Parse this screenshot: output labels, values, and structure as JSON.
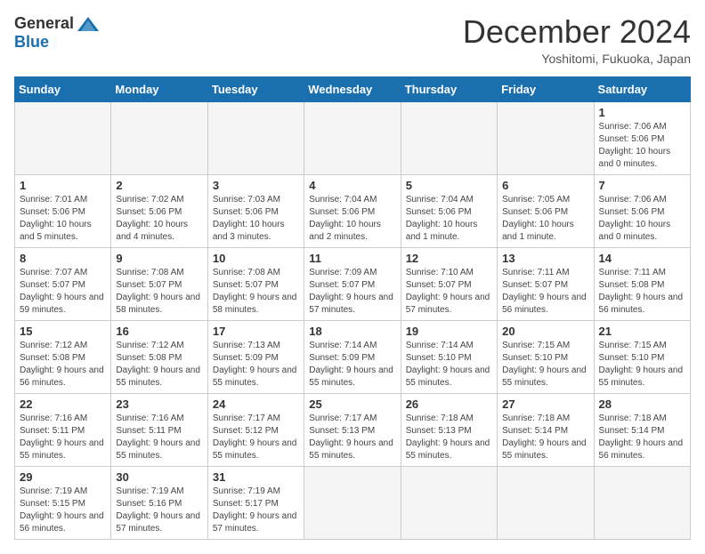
{
  "header": {
    "logo_general": "General",
    "logo_blue": "Blue",
    "month_title": "December 2024",
    "subtitle": "Yoshitomi, Fukuoka, Japan"
  },
  "calendar": {
    "days_of_week": [
      "Sunday",
      "Monday",
      "Tuesday",
      "Wednesday",
      "Thursday",
      "Friday",
      "Saturday"
    ],
    "weeks": [
      [
        {
          "day": "",
          "empty": true
        },
        {
          "day": "",
          "empty": true
        },
        {
          "day": "",
          "empty": true
        },
        {
          "day": "",
          "empty": true
        },
        {
          "day": "",
          "empty": true
        },
        {
          "day": "",
          "empty": true
        },
        {
          "day": "1",
          "sunrise": "7:06 AM",
          "sunset": "5:06 PM",
          "daylight": "10 hours and 0 minutes."
        }
      ],
      [
        {
          "day": "1",
          "sunrise": "7:01 AM",
          "sunset": "5:06 PM",
          "daylight": "10 hours and 5 minutes."
        },
        {
          "day": "2",
          "sunrise": "7:02 AM",
          "sunset": "5:06 PM",
          "daylight": "10 hours and 4 minutes."
        },
        {
          "day": "3",
          "sunrise": "7:03 AM",
          "sunset": "5:06 PM",
          "daylight": "10 hours and 3 minutes."
        },
        {
          "day": "4",
          "sunrise": "7:04 AM",
          "sunset": "5:06 PM",
          "daylight": "10 hours and 2 minutes."
        },
        {
          "day": "5",
          "sunrise": "7:04 AM",
          "sunset": "5:06 PM",
          "daylight": "10 hours and 1 minute."
        },
        {
          "day": "6",
          "sunrise": "7:05 AM",
          "sunset": "5:06 PM",
          "daylight": "10 hours and 1 minute."
        },
        {
          "day": "7",
          "sunrise": "7:06 AM",
          "sunset": "5:06 PM",
          "daylight": "10 hours and 0 minutes."
        }
      ],
      [
        {
          "day": "8",
          "sunrise": "7:07 AM",
          "sunset": "5:07 PM",
          "daylight": "9 hours and 59 minutes."
        },
        {
          "day": "9",
          "sunrise": "7:08 AM",
          "sunset": "5:07 PM",
          "daylight": "9 hours and 58 minutes."
        },
        {
          "day": "10",
          "sunrise": "7:08 AM",
          "sunset": "5:07 PM",
          "daylight": "9 hours and 58 minutes."
        },
        {
          "day": "11",
          "sunrise": "7:09 AM",
          "sunset": "5:07 PM",
          "daylight": "9 hours and 57 minutes."
        },
        {
          "day": "12",
          "sunrise": "7:10 AM",
          "sunset": "5:07 PM",
          "daylight": "9 hours and 57 minutes."
        },
        {
          "day": "13",
          "sunrise": "7:11 AM",
          "sunset": "5:07 PM",
          "daylight": "9 hours and 56 minutes."
        },
        {
          "day": "14",
          "sunrise": "7:11 AM",
          "sunset": "5:08 PM",
          "daylight": "9 hours and 56 minutes."
        }
      ],
      [
        {
          "day": "15",
          "sunrise": "7:12 AM",
          "sunset": "5:08 PM",
          "daylight": "9 hours and 56 minutes."
        },
        {
          "day": "16",
          "sunrise": "7:12 AM",
          "sunset": "5:08 PM",
          "daylight": "9 hours and 55 minutes."
        },
        {
          "day": "17",
          "sunrise": "7:13 AM",
          "sunset": "5:09 PM",
          "daylight": "9 hours and 55 minutes."
        },
        {
          "day": "18",
          "sunrise": "7:14 AM",
          "sunset": "5:09 PM",
          "daylight": "9 hours and 55 minutes."
        },
        {
          "day": "19",
          "sunrise": "7:14 AM",
          "sunset": "5:10 PM",
          "daylight": "9 hours and 55 minutes."
        },
        {
          "day": "20",
          "sunrise": "7:15 AM",
          "sunset": "5:10 PM",
          "daylight": "9 hours and 55 minutes."
        },
        {
          "day": "21",
          "sunrise": "7:15 AM",
          "sunset": "5:10 PM",
          "daylight": "9 hours and 55 minutes."
        }
      ],
      [
        {
          "day": "22",
          "sunrise": "7:16 AM",
          "sunset": "5:11 PM",
          "daylight": "9 hours and 55 minutes."
        },
        {
          "day": "23",
          "sunrise": "7:16 AM",
          "sunset": "5:11 PM",
          "daylight": "9 hours and 55 minutes."
        },
        {
          "day": "24",
          "sunrise": "7:17 AM",
          "sunset": "5:12 PM",
          "daylight": "9 hours and 55 minutes."
        },
        {
          "day": "25",
          "sunrise": "7:17 AM",
          "sunset": "5:13 PM",
          "daylight": "9 hours and 55 minutes."
        },
        {
          "day": "26",
          "sunrise": "7:18 AM",
          "sunset": "5:13 PM",
          "daylight": "9 hours and 55 minutes."
        },
        {
          "day": "27",
          "sunrise": "7:18 AM",
          "sunset": "5:14 PM",
          "daylight": "9 hours and 55 minutes."
        },
        {
          "day": "28",
          "sunrise": "7:18 AM",
          "sunset": "5:14 PM",
          "daylight": "9 hours and 56 minutes."
        }
      ],
      [
        {
          "day": "29",
          "sunrise": "7:19 AM",
          "sunset": "5:15 PM",
          "daylight": "9 hours and 56 minutes."
        },
        {
          "day": "30",
          "sunrise": "7:19 AM",
          "sunset": "5:16 PM",
          "daylight": "9 hours and 57 minutes."
        },
        {
          "day": "31",
          "sunrise": "7:19 AM",
          "sunset": "5:17 PM",
          "daylight": "9 hours and 57 minutes."
        },
        {
          "day": "",
          "empty": true
        },
        {
          "day": "",
          "empty": true
        },
        {
          "day": "",
          "empty": true
        },
        {
          "day": "",
          "empty": true
        }
      ]
    ]
  }
}
